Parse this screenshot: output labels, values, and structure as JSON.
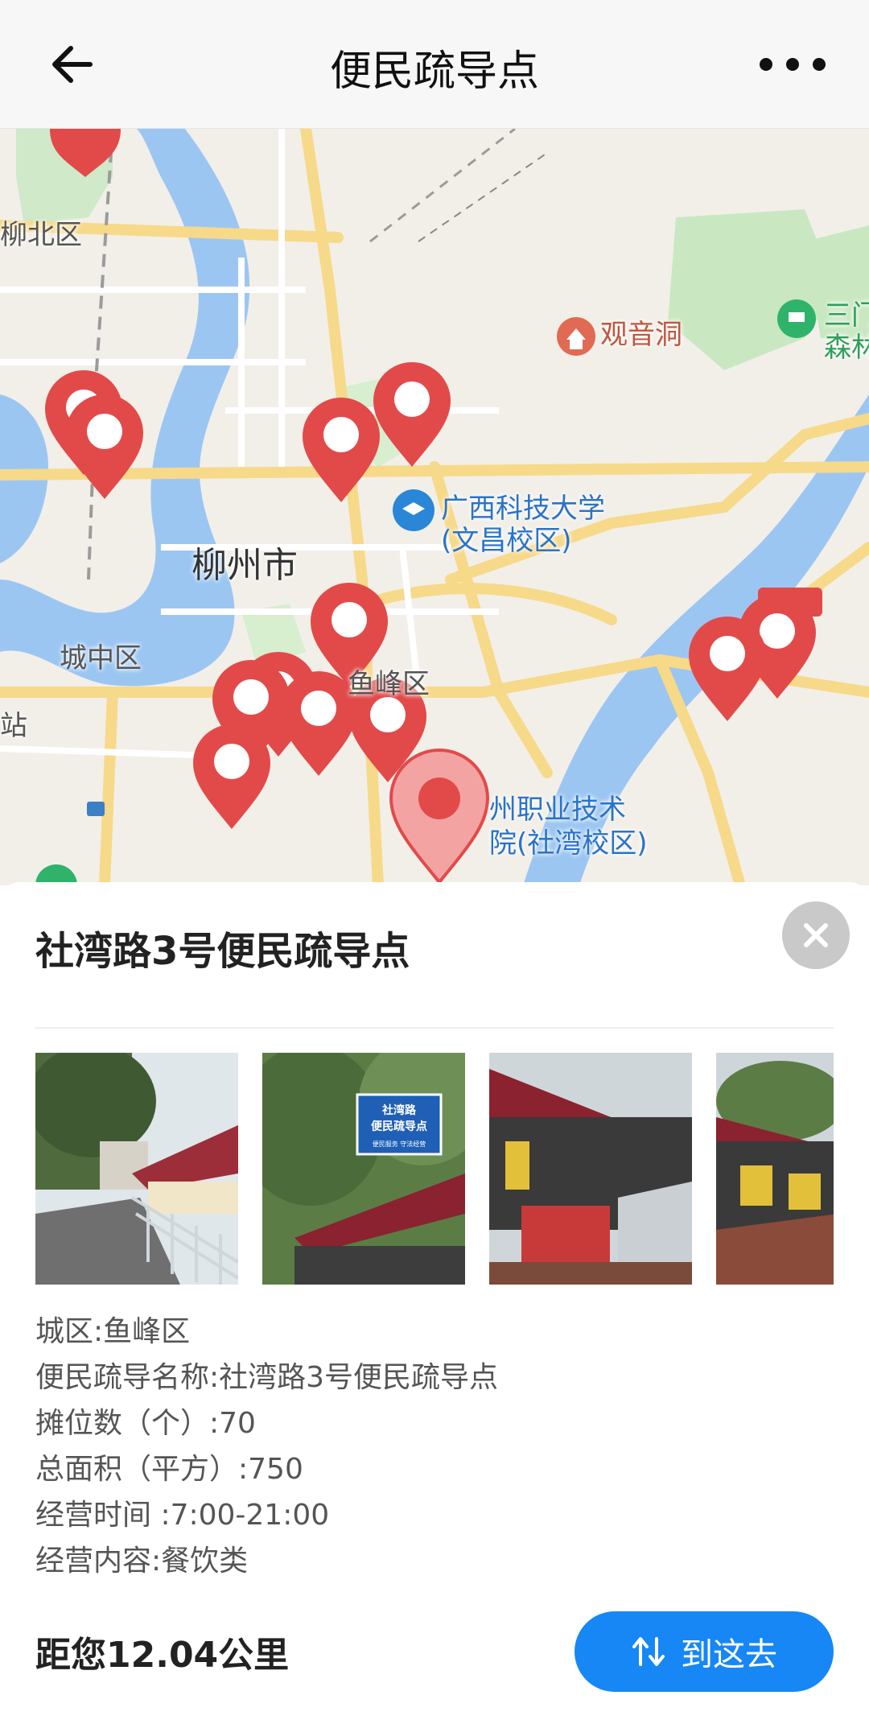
{
  "header": {
    "title": "便民疏导点",
    "back_icon": "back-arrow-icon",
    "more_icon": "more-dots-icon"
  },
  "map": {
    "labels": {
      "liubei": "柳北区",
      "guanyindong": "观音洞",
      "sanmen": "三门",
      "sanmen2": "森林",
      "university": "广西科技大学",
      "university2": "(文昌校区)",
      "city": "柳州市",
      "chengzhong": "城中区",
      "yufeng": "鱼峰区",
      "zhan": "站",
      "college": "州职业技术",
      "college2": "院(社湾校区)"
    },
    "marker_color": "#e24a4a",
    "selected_marker_color": "#f0a0a0"
  },
  "detail": {
    "title": "社湾路3号便民疏导点",
    "close_icon": "close-icon",
    "photos": [
      {
        "name": "photo-street",
        "sign": ""
      },
      {
        "name": "photo-sign",
        "sign_line1": "社湾路",
        "sign_line2": "便民疏导点",
        "sign_line3": "便民服务  守法经营"
      },
      {
        "name": "photo-stalls"
      },
      {
        "name": "photo-stalls-row"
      }
    ],
    "info": {
      "district": "城区:鱼峰区",
      "name": "便民疏导名称:社湾路3号便民疏导点",
      "stalls": "摊位数（个）:70",
      "area": "总面积（平方）:750",
      "hours": "经营时间 :7:00-21:00",
      "content": "经营内容:餐饮类"
    },
    "distance": "距您12.04公里",
    "go_button": "到这去",
    "accent": "#1687f5"
  }
}
